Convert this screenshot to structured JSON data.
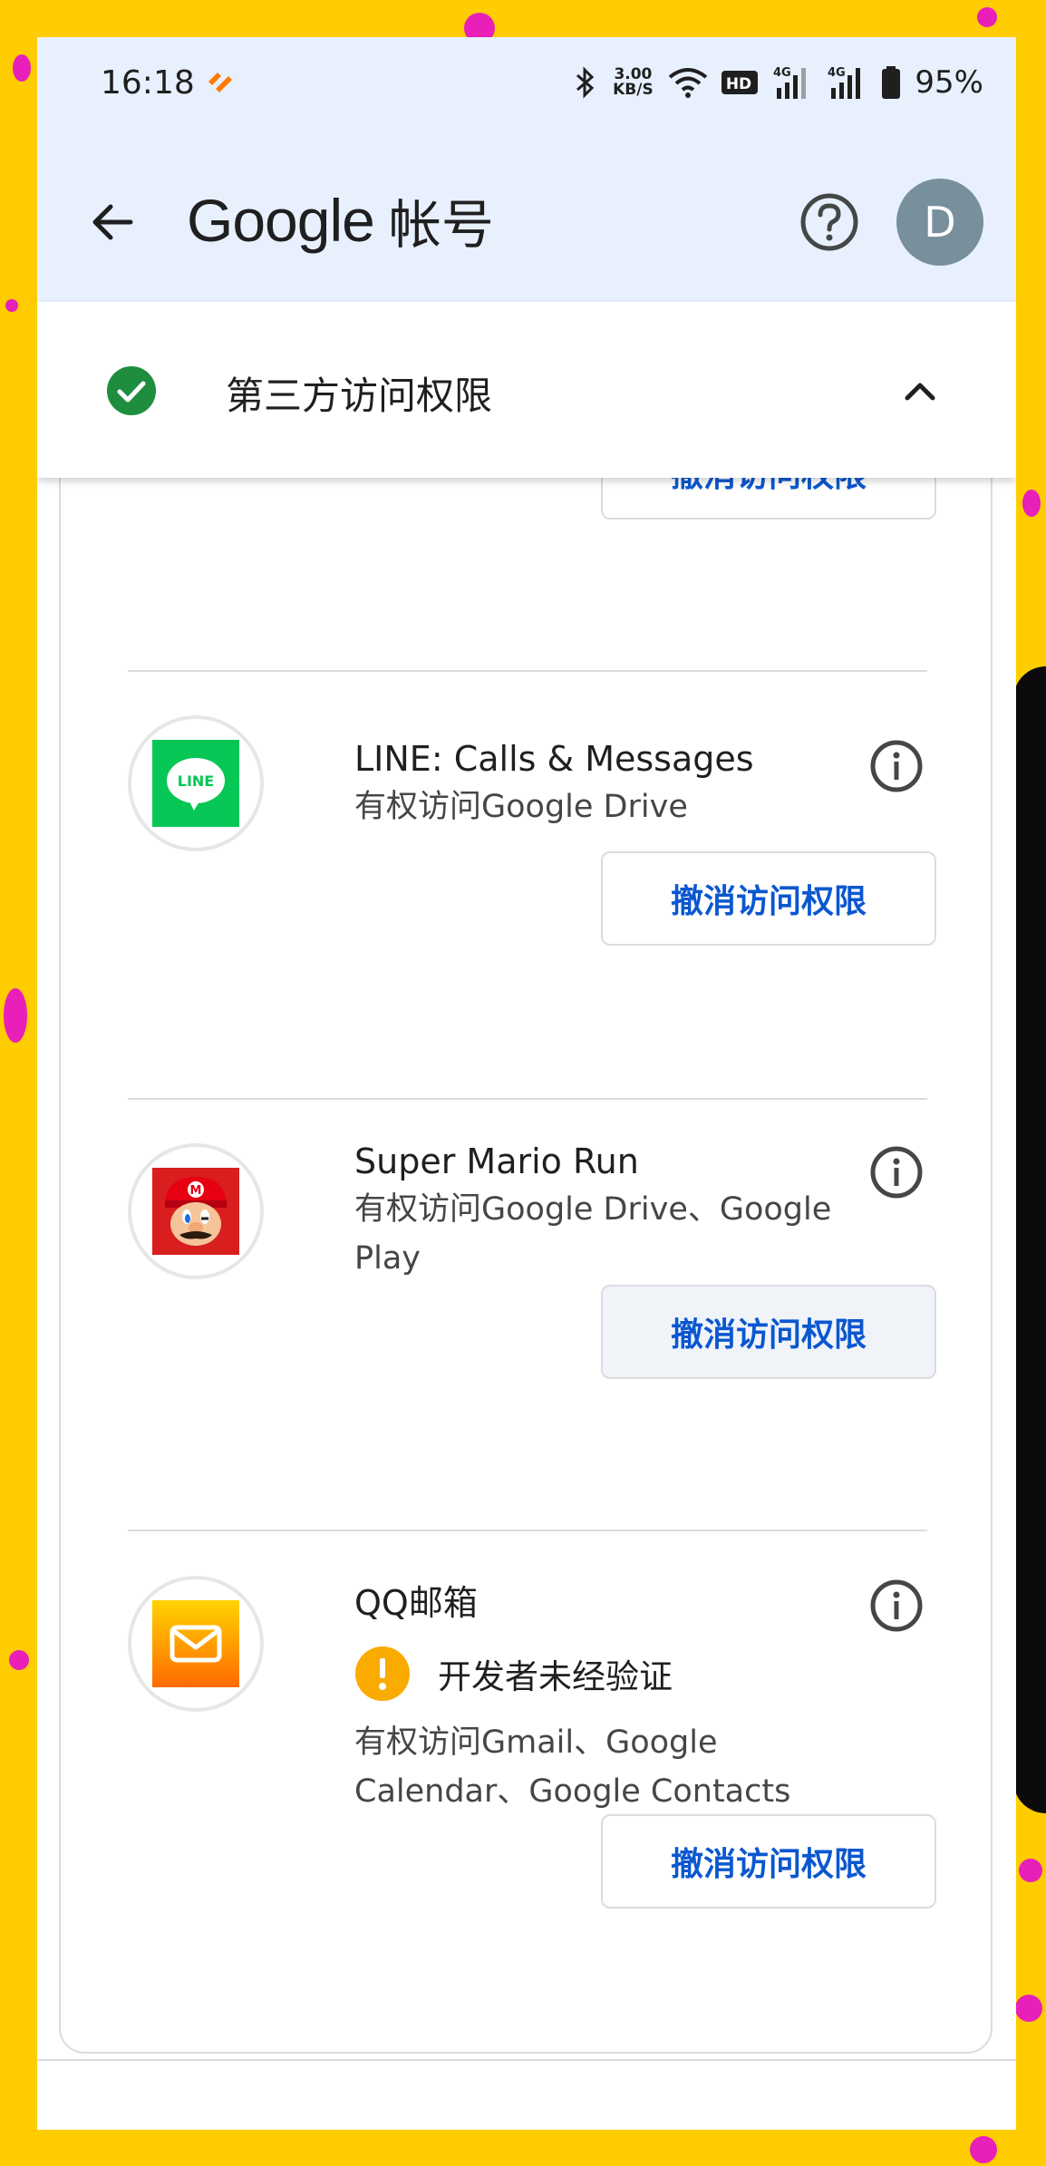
{
  "status_bar": {
    "time": "16:18",
    "network_speed": "3.00\nKB/S",
    "battery": "95%",
    "icons": [
      "bluetooth-icon",
      "wifi-icon",
      "hd-icon",
      "signal-4g-icon",
      "signal-4g-icon",
      "battery-icon"
    ]
  },
  "app_bar": {
    "title_google": "Google",
    "title_suffix": "帐号",
    "avatar_letter": "D"
  },
  "section": {
    "title": "第三方访问权限",
    "expanded": true
  },
  "apps": [
    {
      "name": "LINE: Calls & Messages",
      "access": "有权访问Google Drive",
      "logo_text": "LINE",
      "revoke_label": "撤消访问权限"
    },
    {
      "name": "Super Mario Run",
      "access": "有权访问Google Drive、Google Play",
      "revoke_label": "撤消访问权限"
    },
    {
      "name": "QQ邮箱",
      "warning": "开发者未经验证",
      "access": "有权访问Gmail、Google Calendar、Google Contacts",
      "revoke_label": "撤消访问权限"
    }
  ],
  "top_revoke_label": "撤消访问权限",
  "colors": {
    "accent": "#0b57d0",
    "header_bg": "#e8f0fe",
    "check_green": "#1e8e3e",
    "warning_yellow": "#f9ab00",
    "frame_yellow": "#ffcc00"
  }
}
